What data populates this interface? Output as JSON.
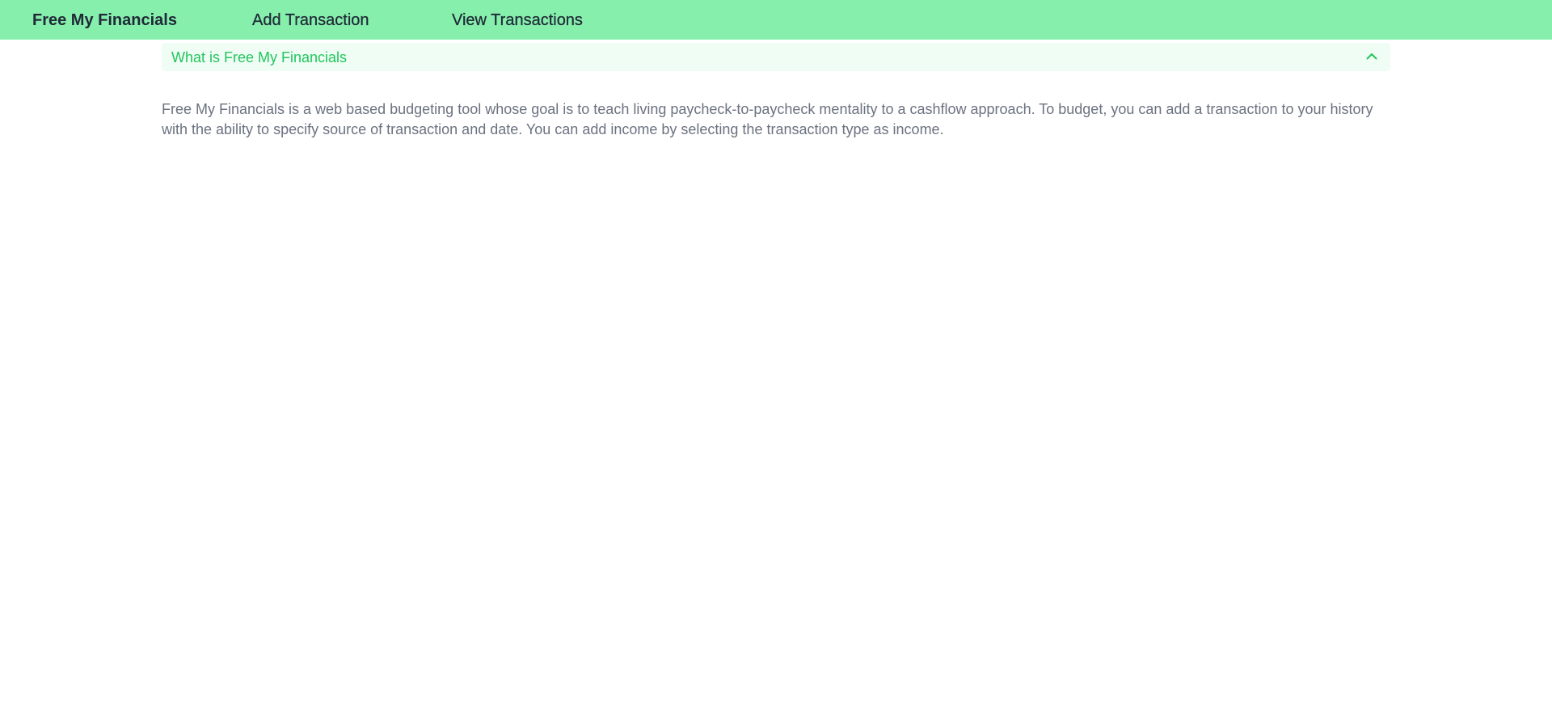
{
  "navbar": {
    "brand": "Free My Financials",
    "links": [
      {
        "label": "Add Transaction"
      },
      {
        "label": "View Transactions"
      }
    ],
    "background_color": "#86efac"
  },
  "accordion": {
    "title": "What is Free My Financials",
    "expanded": true,
    "toggle_icon": "chevron-up-icon",
    "accent_color": "#22c55e",
    "body": "Free My Financials is a web based budgeting tool whose goal is to teach living paycheck-to-paycheck mentality to a cashflow approach. To budget, you can add a transaction to your history with the ability to specify source of transaction and date. You can add income by selecting the transaction type as income."
  }
}
